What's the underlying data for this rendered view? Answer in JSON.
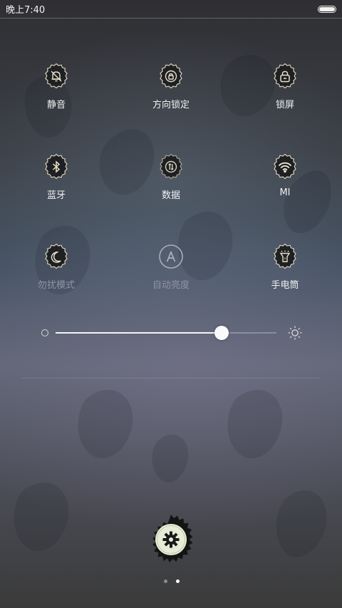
{
  "status_bar": {
    "time": "晚上7:40",
    "battery_icon": "battery-icon"
  },
  "toggles": [
    {
      "label": "静音",
      "icon": "silent-bell-icon",
      "state": "on"
    },
    {
      "label": "方向锁定",
      "icon": "rotation-lock-icon",
      "state": "on"
    },
    {
      "label": "锁屏",
      "icon": "lock-screen-icon",
      "state": "on"
    },
    {
      "label": "蓝牙",
      "icon": "bluetooth-icon",
      "state": "on"
    },
    {
      "label": "数据",
      "icon": "mobile-data-icon",
      "state": "on"
    },
    {
      "label": "MI",
      "icon": "wifi-icon",
      "state": "on"
    },
    {
      "label": "勿扰模式",
      "icon": "do-not-disturb-moon-icon",
      "state": "off"
    },
    {
      "label": "自动亮度",
      "icon": "auto-brightness-icon",
      "state": "off"
    },
    {
      "label": "手电筒",
      "icon": "flashlight-icon",
      "state": "on"
    }
  ],
  "brightness": {
    "level": 0.75,
    "min_icon": "brightness-low-icon",
    "max_icon": "brightness-high-icon"
  },
  "settings": {
    "icon": "gear-icon"
  },
  "pager": {
    "pages": 2,
    "current": 2
  },
  "colors": {
    "badge_fill": "#1f2024",
    "badge_stroke": "#d8d2b8",
    "settings_cream": "#e7ecd6"
  }
}
